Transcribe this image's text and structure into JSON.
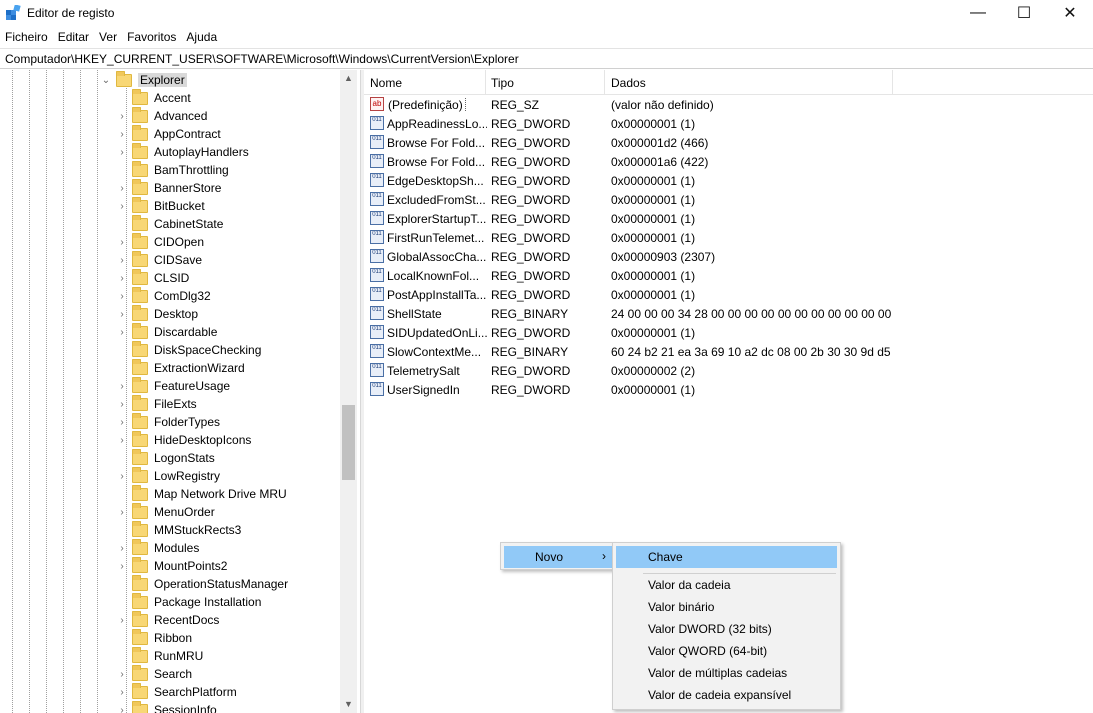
{
  "window": {
    "title": "Editor de registo",
    "minimize": "—",
    "maximize": "☐",
    "close": "✕"
  },
  "menu": [
    "Ficheiro",
    "Editar",
    "Ver",
    "Favoritos",
    "Ajuda"
  ],
  "address": "Computador\\HKEY_CURRENT_USER\\SOFTWARE\\Microsoft\\Windows\\CurrentVersion\\Explorer",
  "tree": {
    "selected": "Explorer",
    "children": [
      {
        "label": "Accent",
        "expandable": false
      },
      {
        "label": "Advanced",
        "expandable": true
      },
      {
        "label": "AppContract",
        "expandable": true
      },
      {
        "label": "AutoplayHandlers",
        "expandable": true
      },
      {
        "label": "BamThrottling",
        "expandable": false
      },
      {
        "label": "BannerStore",
        "expandable": true
      },
      {
        "label": "BitBucket",
        "expandable": true
      },
      {
        "label": "CabinetState",
        "expandable": false
      },
      {
        "label": "CIDOpen",
        "expandable": true
      },
      {
        "label": "CIDSave",
        "expandable": true
      },
      {
        "label": "CLSID",
        "expandable": true
      },
      {
        "label": "ComDlg32",
        "expandable": true
      },
      {
        "label": "Desktop",
        "expandable": true
      },
      {
        "label": "Discardable",
        "expandable": true
      },
      {
        "label": "DiskSpaceChecking",
        "expandable": false
      },
      {
        "label": "ExtractionWizard",
        "expandable": false
      },
      {
        "label": "FeatureUsage",
        "expandable": true
      },
      {
        "label": "FileExts",
        "expandable": true
      },
      {
        "label": "FolderTypes",
        "expandable": true
      },
      {
        "label": "HideDesktopIcons",
        "expandable": true
      },
      {
        "label": "LogonStats",
        "expandable": false
      },
      {
        "label": "LowRegistry",
        "expandable": true
      },
      {
        "label": "Map Network Drive MRU",
        "expandable": false
      },
      {
        "label": "MenuOrder",
        "expandable": true
      },
      {
        "label": "MMStuckRects3",
        "expandable": false
      },
      {
        "label": "Modules",
        "expandable": true
      },
      {
        "label": "MountPoints2",
        "expandable": true
      },
      {
        "label": "OperationStatusManager",
        "expandable": false
      },
      {
        "label": "Package Installation",
        "expandable": false
      },
      {
        "label": "RecentDocs",
        "expandable": true
      },
      {
        "label": "Ribbon",
        "expandable": false
      },
      {
        "label": "RunMRU",
        "expandable": false
      },
      {
        "label": "Search",
        "expandable": true
      },
      {
        "label": "SearchPlatform",
        "expandable": true
      },
      {
        "label": "SessionInfo",
        "expandable": true
      }
    ]
  },
  "columns": {
    "name": "Nome",
    "type": "Tipo",
    "data": "Dados"
  },
  "values": [
    {
      "name": "(Predefinição)",
      "type": "REG_SZ",
      "data": "(valor não definido)",
      "icon": "ab"
    },
    {
      "name": "AppReadinessLo...",
      "type": "REG_DWORD",
      "data": "0x00000001 (1)",
      "icon": "011"
    },
    {
      "name": "Browse For Fold...",
      "type": "REG_DWORD",
      "data": "0x000001d2 (466)",
      "icon": "011"
    },
    {
      "name": "Browse For Fold...",
      "type": "REG_DWORD",
      "data": "0x000001a6 (422)",
      "icon": "011"
    },
    {
      "name": "EdgeDesktopSh...",
      "type": "REG_DWORD",
      "data": "0x00000001 (1)",
      "icon": "011"
    },
    {
      "name": "ExcludedFromSt...",
      "type": "REG_DWORD",
      "data": "0x00000001 (1)",
      "icon": "011"
    },
    {
      "name": "ExplorerStartupT...",
      "type": "REG_DWORD",
      "data": "0x00000001 (1)",
      "icon": "011"
    },
    {
      "name": "FirstRunTelemet...",
      "type": "REG_DWORD",
      "data": "0x00000001 (1)",
      "icon": "011"
    },
    {
      "name": "GlobalAssocCha...",
      "type": "REG_DWORD",
      "data": "0x00000903 (2307)",
      "icon": "011"
    },
    {
      "name": "LocalKnownFol...",
      "type": "REG_DWORD",
      "data": "0x00000001 (1)",
      "icon": "011"
    },
    {
      "name": "PostAppInstallTa...",
      "type": "REG_DWORD",
      "data": "0x00000001 (1)",
      "icon": "011"
    },
    {
      "name": "ShellState",
      "type": "REG_BINARY",
      "data": "24 00 00 00 34 28 00 00 00 00 00 00 00 00 00 00 00 00...",
      "icon": "011"
    },
    {
      "name": "SIDUpdatedOnLi...",
      "type": "REG_DWORD",
      "data": "0x00000001 (1)",
      "icon": "011"
    },
    {
      "name": "SlowContextMe...",
      "type": "REG_BINARY",
      "data": "60 24 b2 21 ea 3a 69 10 a2 dc 08 00 2b 30 30 9d d5 0...",
      "icon": "011"
    },
    {
      "name": "TelemetrySalt",
      "type": "REG_DWORD",
      "data": "0x00000002 (2)",
      "icon": "011"
    },
    {
      "name": "UserSignedIn",
      "type": "REG_DWORD",
      "data": "0x00000001 (1)",
      "icon": "011"
    }
  ],
  "context_menu": {
    "item": "Novo",
    "arrow": "›",
    "submenu": [
      "Chave",
      "Valor da cadeia",
      "Valor binário",
      "Valor DWORD (32 bits)",
      "Valor QWORD (64-bit)",
      "Valor de múltiplas cadeias",
      "Valor de cadeia expansível"
    ]
  },
  "scrollbar": {
    "up": "▲",
    "down": "▼"
  },
  "colors": {
    "highlight": "#91c9f7",
    "folder": "#f8d775",
    "menu_bg": "#f2f2f2"
  }
}
